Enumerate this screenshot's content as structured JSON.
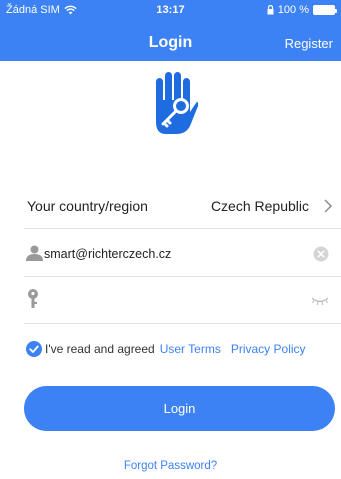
{
  "status_bar": {
    "carrier": "Žádná SIM",
    "time": "13:17",
    "battery": "100 %",
    "icons": [
      "wifi-icon",
      "battery-icon"
    ]
  },
  "nav": {
    "title": "Login",
    "register_label": "Register"
  },
  "logo": {
    "icon": "hand-key-icon"
  },
  "region": {
    "label": "Your country/region",
    "value": "Czech Republic",
    "icon": "chevron-right-icon"
  },
  "email": {
    "value": "smart@richterczech.cz",
    "icon": "person-icon",
    "clear_icon": "clear-icon"
  },
  "password": {
    "value": "",
    "icon": "key-icon",
    "toggle_icon": "eye-closed-icon"
  },
  "agreement": {
    "checked": true,
    "text": "I've read and agreed",
    "user_terms": "User Terms",
    "privacy_policy": "Privacy Policy"
  },
  "login_button": {
    "label": "Login"
  },
  "forgot": {
    "label": "Forgot Password?"
  },
  "colors": {
    "accent": "#3d82f4",
    "divider": "#e3e3e3",
    "icon_gray": "#9a9a9a"
  }
}
